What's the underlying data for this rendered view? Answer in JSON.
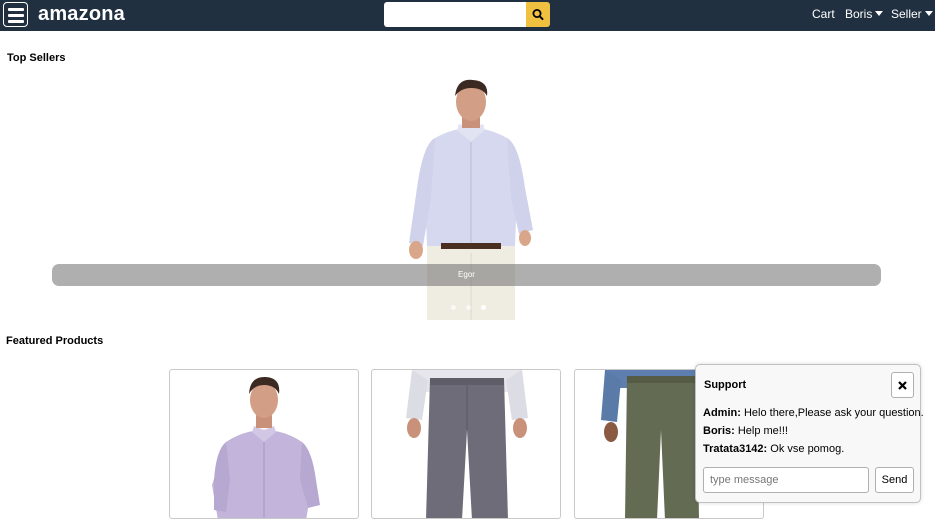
{
  "header": {
    "brand": "amazona",
    "search": {
      "value": "",
      "placeholder": ""
    },
    "nav": {
      "cart": "Cart",
      "user": "Boris",
      "seller": "Seller"
    }
  },
  "top_sellers": {
    "title": "Top Sellers",
    "carousel": {
      "legend": "Egor",
      "image_icon": "seller-photo"
    }
  },
  "featured": {
    "title": "Featured Products",
    "products": [
      {
        "image_icon": "purple-shirt-photo"
      },
      {
        "image_icon": "gray-pants-photo"
      },
      {
        "image_icon": "olive-pants-photo"
      }
    ]
  },
  "support": {
    "title": "Support",
    "messages": [
      {
        "from": "Admin:",
        "text": "Helo there,Please ask your question."
      },
      {
        "from": "Boris:",
        "text": "Help me!!!"
      },
      {
        "from": "Tratata3142:",
        "text": "Ok vse pomog."
      }
    ],
    "input": {
      "value": "",
      "placeholder": "type message"
    },
    "send_label": "Send"
  },
  "colors": {
    "header_bg": "#203040",
    "search_button": "#f0c040"
  }
}
